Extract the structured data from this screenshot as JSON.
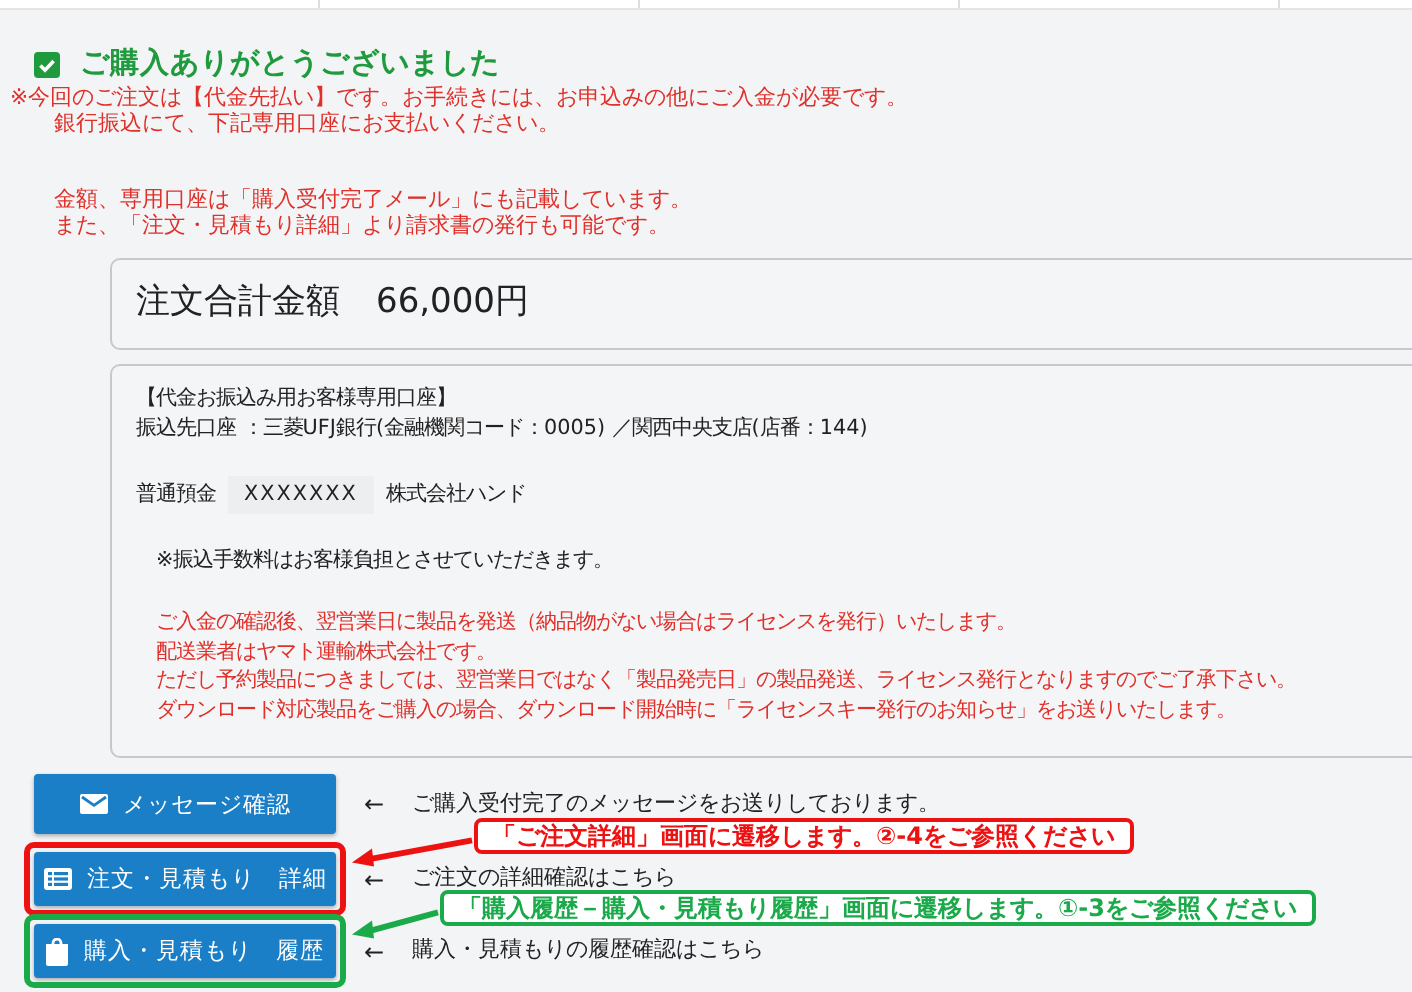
{
  "heading": {
    "text": "ご購入ありがとうございました",
    "checked": true
  },
  "notice_groups": [
    [
      "※今回のご注文は【代金先払い】です。お手続きには、お申込みの他にご入金が必要です。",
      "銀行振込にて、下記専用口座にお支払いください。"
    ],
    [
      "金額、専用口座は「購入受付完了メール」にも記載しています。",
      "また、「注文・見積もり詳細」より請求書の発行も可能です。"
    ]
  ],
  "total": {
    "label": "注文合計金額",
    "amount": "66,000円"
  },
  "account": {
    "title": "【代金お振込み用お客様専用口座】",
    "bank_line": "振込先口座 ：三菱UFJ銀行(金融機関コード：0005) ／関西中央支店(店番：144)",
    "type": "普通預金",
    "number": "XXXXXXX",
    "holder": "株式会社ハンド",
    "fee_note": "※振込手数料はお客様負担とさせていただきます。",
    "notes": [
      "ご入金の確認後、翌営業日に製品を発送（納品物がない場合はライセンスを発行）いたします。",
      "配送業者はヤマト運輸株式会社です。",
      "ただし予約製品につきましては、翌営業日ではなく「製品発売日」の製品発送、ライセンス発行となりますのでご了承下さい。",
      "ダウンロード対応製品をご購入の場合、ダウンロード開始時に「ライセンスキー発行のお知らせ」をお送りいたします。"
    ]
  },
  "actions": [
    {
      "kind": "message",
      "label": "メッセージ確認",
      "arrow": "←",
      "note": "ご購入受付完了のメッセージをお送りしております。"
    },
    {
      "kind": "detail",
      "label": "注文・見積もり　詳細",
      "arrow": "←",
      "note": "ご注文の詳細確認はこちら",
      "callout": {
        "text": "「ご注文詳細」画面に遷移します。②-4をご参照ください",
        "color": "#ee1111"
      }
    },
    {
      "kind": "history",
      "label": "購入・見積もり　履歴",
      "arrow": "←",
      "note": "購入・見積もりの履歴確認はこちら",
      "callout": {
        "text": "「購入履歴－購入・見積もり履歴」画面に遷移します。①-3をご参照ください",
        "color": "#1aaa4a"
      }
    }
  ]
}
